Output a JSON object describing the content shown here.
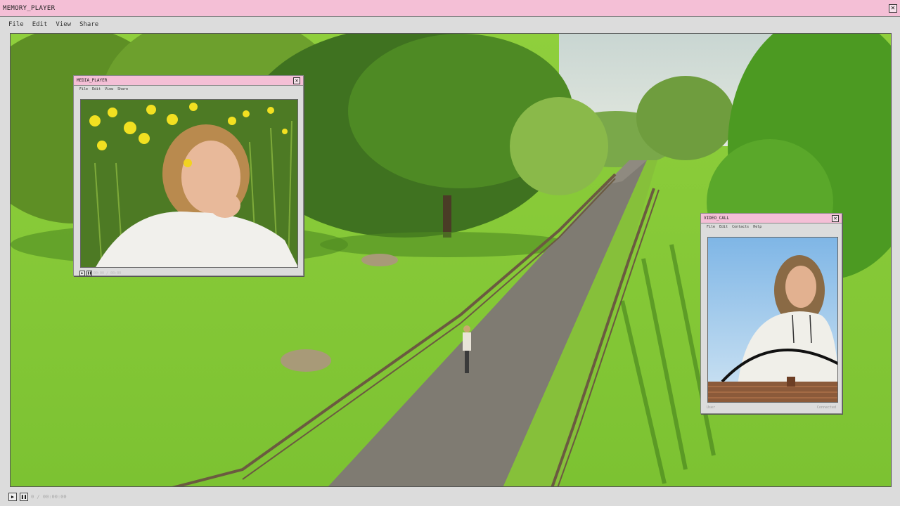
{
  "main_window": {
    "title": "MEMORY_PLAYER",
    "menu": [
      "File",
      "Edit",
      "View",
      "Share"
    ],
    "status_text": "0 / 00:00:00"
  },
  "media_player": {
    "title": "MEDIA_PLAYER",
    "menu": [
      "File",
      "Edit",
      "View",
      "Share"
    ],
    "status_text": "00:00 / 00:00"
  },
  "video_call": {
    "title": "VIDEO_CALL",
    "menu": [
      "File",
      "Edit",
      "Contacts",
      "Help"
    ],
    "caller_label": "User",
    "caller_status": "Connected",
    "call_status": "Connected"
  },
  "icons": {
    "close": "close-icon",
    "play": "play-icon",
    "pause": "pause-icon"
  },
  "colors": {
    "titlebar": "#f4bfd6",
    "chrome": "#dcdcdc"
  }
}
